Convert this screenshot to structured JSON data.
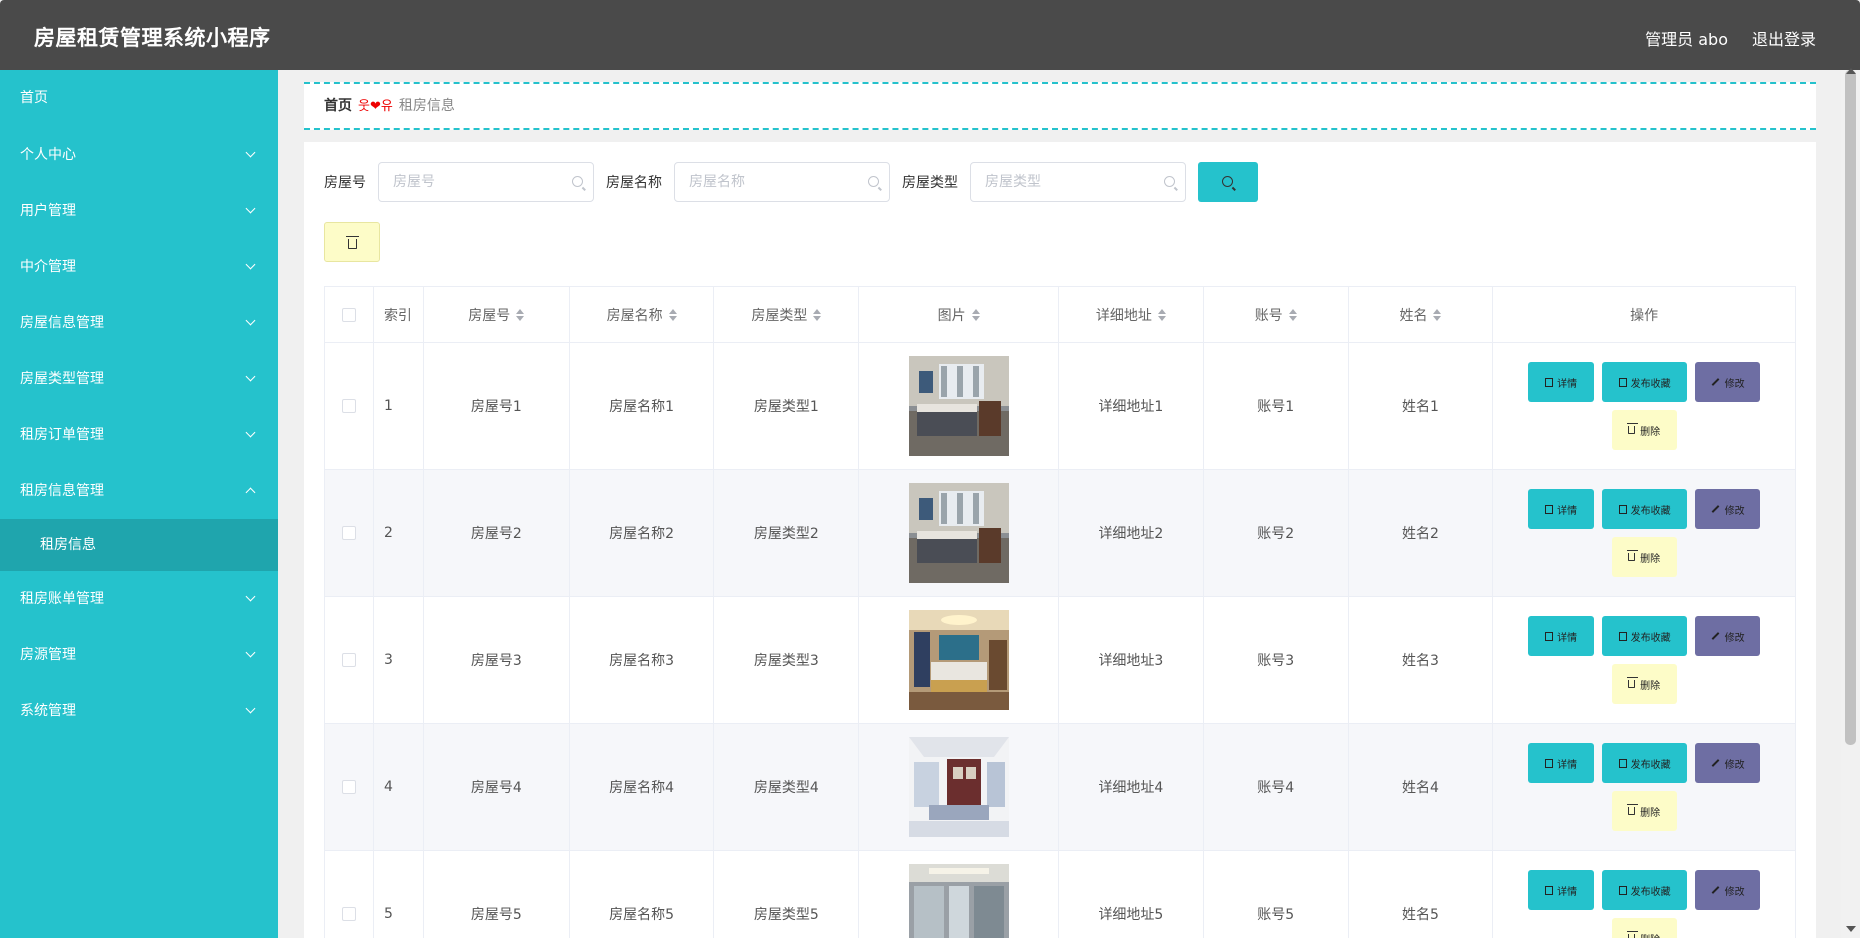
{
  "app": {
    "title": "房屋租赁管理系统小程序",
    "user": "管理员 abo",
    "logout": "退出登录"
  },
  "sidebar": {
    "items": [
      {
        "label": "首页",
        "expandable": false
      },
      {
        "label": "个人中心",
        "expandable": true
      },
      {
        "label": "用户管理",
        "expandable": true
      },
      {
        "label": "中介管理",
        "expandable": true
      },
      {
        "label": "房屋信息管理",
        "expandable": true
      },
      {
        "label": "房屋类型管理",
        "expandable": true
      },
      {
        "label": "租房订单管理",
        "expandable": true
      },
      {
        "label": "租房信息管理",
        "expandable": true,
        "expanded": true
      },
      {
        "label": "租房账单管理",
        "expandable": true
      },
      {
        "label": "房源管理",
        "expandable": true
      },
      {
        "label": "系统管理",
        "expandable": true
      }
    ],
    "sub_item": "租房信息"
  },
  "breadcrumb": {
    "home": "首页",
    "separator": "웃❤유",
    "current": "租房信息"
  },
  "search": {
    "fields": [
      {
        "label": "房屋号",
        "placeholder": "房屋号"
      },
      {
        "label": "房屋名称",
        "placeholder": "房屋名称"
      },
      {
        "label": "房屋类型",
        "placeholder": "房屋类型"
      }
    ]
  },
  "table": {
    "headers": [
      "索引",
      "房屋号",
      "房屋名称",
      "房屋类型",
      "图片",
      "详细地址",
      "账号",
      "姓名",
      "操作"
    ],
    "rows": [
      {
        "index": "1",
        "house_no": "房屋号1",
        "house_name": "房屋名称1",
        "house_type": "房屋类型1",
        "address": "详细地址1",
        "account": "账号1",
        "name": "姓名1"
      },
      {
        "index": "2",
        "house_no": "房屋号2",
        "house_name": "房屋名称2",
        "house_type": "房屋类型2",
        "address": "详细地址2",
        "account": "账号2",
        "name": "姓名2"
      },
      {
        "index": "3",
        "house_no": "房屋号3",
        "house_name": "房屋名称3",
        "house_type": "房屋类型3",
        "address": "详细地址3",
        "account": "账号3",
        "name": "姓名3"
      },
      {
        "index": "4",
        "house_no": "房屋号4",
        "house_name": "房屋名称4",
        "house_type": "房屋类型4",
        "address": "详细地址4",
        "account": "账号4",
        "name": "姓名4"
      },
      {
        "index": "5",
        "house_no": "房屋号5",
        "house_name": "房屋名称5",
        "house_type": "房屋类型5",
        "address": "详细地址5",
        "account": "账号5",
        "name": "姓名5"
      }
    ],
    "actions": {
      "detail": "详情",
      "publish": "发布收藏",
      "edit": "修改",
      "delete": "删除"
    }
  },
  "colors": {
    "topbar": "#4a4a4a",
    "sidebar": "#25c2cc",
    "sidebar_active": "#1fa5ad",
    "accent": "#25c2cc",
    "edit": "#6e6ea3",
    "delete": "#fdfcc8"
  },
  "icons": {
    "search": "search-icon",
    "delete": "trash-icon",
    "expand": "chevron-down-icon",
    "collapse": "chevron-up-icon",
    "sort": "sort-icon"
  }
}
